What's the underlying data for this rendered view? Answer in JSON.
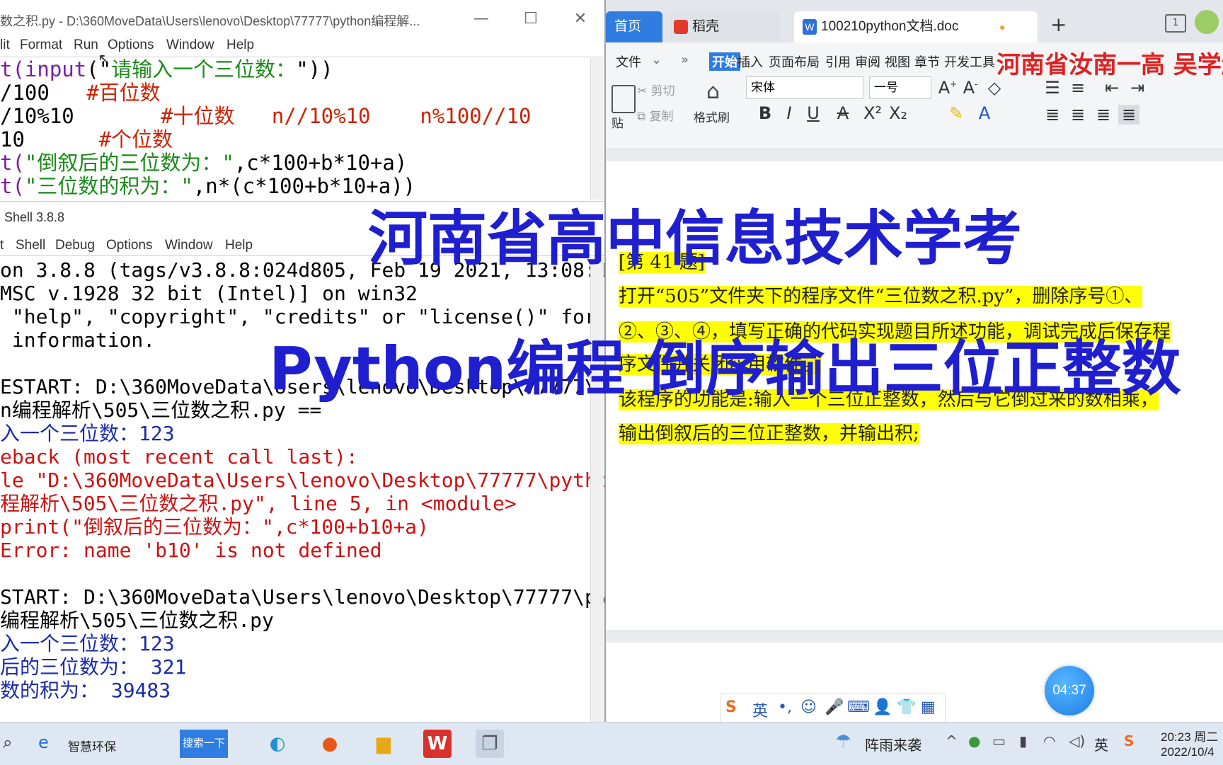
{
  "overlay": {
    "headline": "河南省高中信息技术学考",
    "subheadline": "Python编程 倒序输出三位正整数",
    "author": "河南省汝南一高 吴学超录"
  },
  "editor": {
    "title": "数之积.py - D:\\360MoveData\\Users\\lenovo\\Desktop\\77777\\python编程解...",
    "menu": [
      "lit",
      "Format",
      "Run",
      "Options",
      "Window",
      "Help"
    ],
    "code": [
      {
        "a": "t(",
        "b": "input",
        "c": "(\"",
        "d": "请输入一个三位数：",
        "e": "\"))"
      },
      {
        "a": "/100   ",
        "b": "#百位数"
      },
      {
        "a": "/10%10       ",
        "b": "#十位数   n//10%10    n%100//10"
      },
      {
        "a": "10      ",
        "b": "#个位数"
      },
      {
        "a": "t(",
        "b": "\"倒叙后的三位数为：\"",
        "c": ",c*100+b*10+a)"
      },
      {
        "a": "t(",
        "b": "\"三位数的积为：\"",
        "c": ",n*(c*100+b*10+a))"
      }
    ]
  },
  "shell": {
    "title": "Shell 3.8.8",
    "menu": [
      "t",
      "Shell",
      "Debug",
      "Options",
      "Window",
      "Help"
    ],
    "lines": [
      {
        "t": "on 3.8.8 (tags/v3.8.8:024d805, Feb 19 2021, 13:08:1",
        "c": "out"
      },
      {
        "t": "MSC v.1928 32 bit (Intel)] on win32",
        "c": "out"
      },
      {
        "t": " \"help\", \"copyright\", \"credits\" or \"license()\" for",
        "c": "out"
      },
      {
        "t": " information.",
        "c": "out"
      },
      {
        "t": "",
        "c": "out"
      },
      {
        "t": "ESTART: D:\\360MoveData\\Users\\lenovo\\Desktop\\77777\\p",
        "c": "out"
      },
      {
        "t": "n编程解析\\505\\三位数之积.py ==",
        "c": "out"
      },
      {
        "t": "入一个三位数：123",
        "c": "blue"
      },
      {
        "t": "eback (most recent call last):",
        "c": "err"
      },
      {
        "t": "le \"D:\\360MoveData\\Users\\lenovo\\Desktop\\77777\\pytho",
        "c": "err"
      },
      {
        "t": "程解析\\505\\三位数之积.py\", line 5, in <module>",
        "c": "err"
      },
      {
        "t": "print(\"倒叙后的三位数为：\",c*100+b10+a)",
        "c": "err"
      },
      {
        "t": "Error: name 'b10' is not defined",
        "c": "err"
      },
      {
        "t": "",
        "c": "out"
      },
      {
        "t": "START: D:\\360MoveData\\Users\\lenovo\\Desktop\\77777\\py",
        "c": "out"
      },
      {
        "t": "编程解析\\505\\三位数之积.py",
        "c": "out"
      },
      {
        "t": "入一个三位数：123",
        "c": "blue"
      },
      {
        "t": "后的三位数为： 321",
        "c": "blue"
      },
      {
        "t": "数的积为： 39483",
        "c": "blue"
      }
    ]
  },
  "wps": {
    "tabs": {
      "home": "首页",
      "daoke": "稻壳",
      "doc": "100210python文档.doc",
      "add": "+"
    },
    "menu": {
      "file": "文件",
      "start": "开始",
      "insert": "插入",
      "layout": "页面布局",
      "ref": "引用",
      "review": "审阅",
      "view": "视图",
      "chapter": "章节",
      "dev": "开发工具"
    },
    "ribbon": {
      "cut": "剪切",
      "copy": "复制",
      "paste": "贴",
      "format_painter": "格式刷",
      "font": "宋体",
      "size": "一号"
    },
    "doc": {
      "q_no": "[第 41 题]",
      "p1_l1": "打开“505”文件夹下的程序文件“三位数之积.py”，删除序号①、",
      "p1_l2": "②、③、④，填写正确的代码实现题目所述功能，调试完成后保存程",
      "p1_l3": "序文件并关闭应用软件。",
      "p2_l1": "该程序的功能是:输入一个三位正整数，然后与它倒过来的数相乘，",
      "p2_l2": "输出倒叙后的三位正整数，并输出积;"
    },
    "timer": "04:37",
    "ime_lang": "英"
  },
  "taskbar": {
    "edge_label": "智慧环保",
    "search_btn": "搜索一下",
    "weather": "阵雨来袭",
    "ime": "英",
    "time": "20:23 周二",
    "date": "2022/10/4"
  },
  "colors": {
    "headline": "#1f1fd0",
    "author": "#e02020",
    "highlight": "#ffff00",
    "error": "#cc1111",
    "output": "#1a2aa8"
  }
}
